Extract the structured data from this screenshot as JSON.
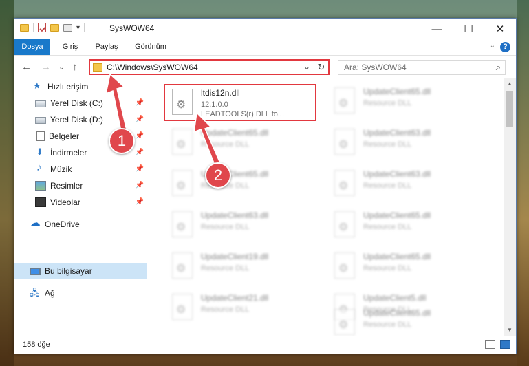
{
  "window": {
    "title": "SysWOW64"
  },
  "controls": {
    "minimize": "—",
    "maximize": "☐",
    "close": "✕"
  },
  "ribbon": {
    "tabs": [
      "Dosya",
      "Giriş",
      "Paylaş",
      "Görünüm"
    ],
    "collapse": "⌄",
    "help": "?"
  },
  "nav": {
    "back": "←",
    "forward": "→",
    "recent": "⌄",
    "up": "↑"
  },
  "address": {
    "path": "C:\\Windows\\SysWOW64",
    "dropdown": "⌄",
    "refresh": "↻"
  },
  "search": {
    "placeholder": "Ara: SysWOW64",
    "icon": "⌕"
  },
  "sidebar": {
    "items": [
      {
        "label": "Hızlı erişim",
        "icon": "star-icon",
        "pinned": false
      },
      {
        "label": "Yerel Disk (C:)",
        "icon": "drive-icon",
        "pinned": true
      },
      {
        "label": "Yerel Disk (D:)",
        "icon": "drive-icon",
        "pinned": true
      },
      {
        "label": "Belgeler",
        "icon": "documents-icon",
        "pinned": true
      },
      {
        "label": "İndirmeler",
        "icon": "downloads-icon",
        "pinned": true
      },
      {
        "label": "Müzik",
        "icon": "music-icon",
        "pinned": true
      },
      {
        "label": "Resimler",
        "icon": "pictures-icon",
        "pinned": true
      },
      {
        "label": "Videolar",
        "icon": "videos-icon",
        "pinned": true
      },
      {
        "label": "OneDrive",
        "icon": "onedrive-icon",
        "pinned": false
      },
      {
        "label": "Bu bilgisayar",
        "icon": "this-pc-icon",
        "pinned": false,
        "selected": true
      },
      {
        "label": "Ağ",
        "icon": "network-icon",
        "pinned": false
      }
    ]
  },
  "files": [
    {
      "name": "ltdis12n.dll",
      "line2": "12.1.0.0",
      "line3": "LEADTOOLS(r) DLL fo...",
      "highlighted": true
    },
    {
      "name": "UpdateClient65.dll",
      "line2": "Resource DLL",
      "line3": ""
    },
    {
      "name": "UpdateClient65.dll",
      "line2": "Resource DLL",
      "line3": ""
    },
    {
      "name": "UpdateClient63.dll",
      "line2": "Resource DLL",
      "line3": ""
    },
    {
      "name": "UpdateClient65.dll",
      "line2": "Resource DLL",
      "line3": ""
    },
    {
      "name": "UpdateClient63.dll",
      "line2": "Resource DLL",
      "line3": ""
    },
    {
      "name": "UpdateClient63.dll",
      "line2": "Resource DLL",
      "line3": ""
    },
    {
      "name": "UpdateClient65.dll",
      "line2": "Resource DLL",
      "line3": ""
    },
    {
      "name": "UpdateClient19.dll",
      "line2": "Resource DLL",
      "line3": ""
    },
    {
      "name": "UpdateClient65.dll",
      "line2": "Resource DLL",
      "line3": ""
    },
    {
      "name": "UpdateClient21.dll",
      "line2": "Resource DLL",
      "line3": ""
    },
    {
      "name": "UpdateClient5.dll",
      "line2": "Resource DLL",
      "line3": ""
    },
    {
      "name": "UpdateClient65.dll",
      "line2": "Resource DLL",
      "line3": ""
    }
  ],
  "status": {
    "count": "158 öğe"
  },
  "callouts": [
    "1",
    "2"
  ],
  "colors": {
    "accent": "#1979ca",
    "highlight": "#e2383f",
    "callout": "#e0474c"
  }
}
